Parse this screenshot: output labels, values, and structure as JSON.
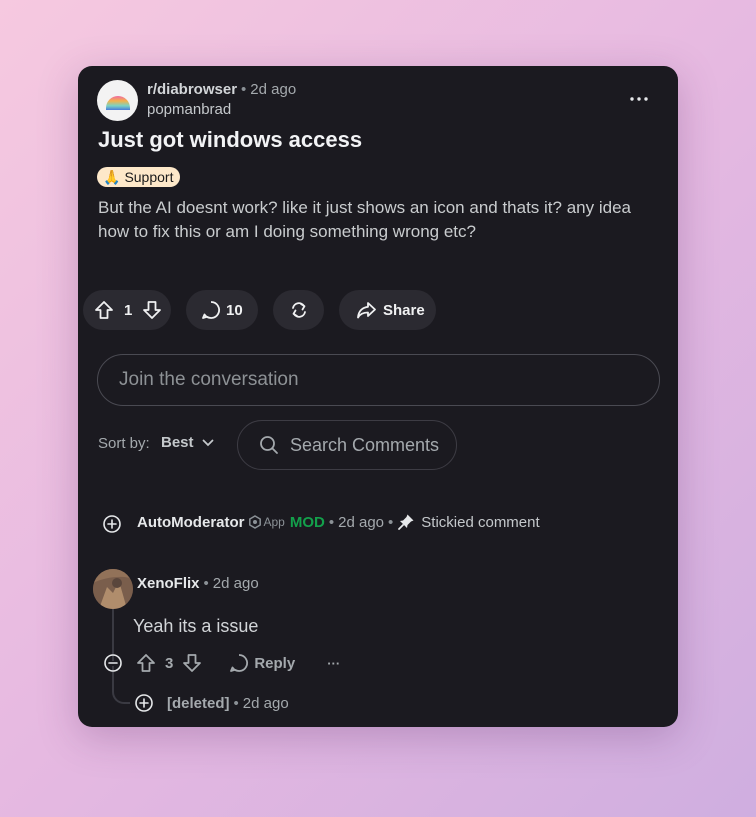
{
  "post": {
    "subreddit": "r/diabrowser",
    "separator": "•",
    "time": "2d ago",
    "author": "popmanbrad",
    "title": "Just got windows access",
    "flair_emoji": "🙏",
    "flair": "Support",
    "body": "But the AI doesnt work? like it just shows an icon and thats it? any idea how to fix this or am I doing something wrong etc?"
  },
  "actions": {
    "votes": "1",
    "comments": "10",
    "share_label": "Share"
  },
  "join": {
    "placeholder": "Join the conversation"
  },
  "sort": {
    "label": "Sort by:",
    "value": "Best"
  },
  "search": {
    "placeholder": "Search Comments"
  },
  "comments": {
    "automod": {
      "author": "AutoModerator",
      "app_tag": "App",
      "mod_tag": "MOD",
      "time": "2d ago",
      "stickied": "Stickied comment"
    },
    "xenoflix": {
      "author": "XenoFlix",
      "time": "2d ago",
      "body": "Yeah its a issue",
      "votes": "3",
      "reply_label": "Reply",
      "more": "···"
    },
    "deleted": {
      "author": "[deleted]",
      "time": "2d ago"
    }
  },
  "colors": {
    "background": "#1b1a20",
    "pill": "#2b2a31",
    "mod_green": "#13a04b",
    "flair_bg": "#fde8c9"
  }
}
